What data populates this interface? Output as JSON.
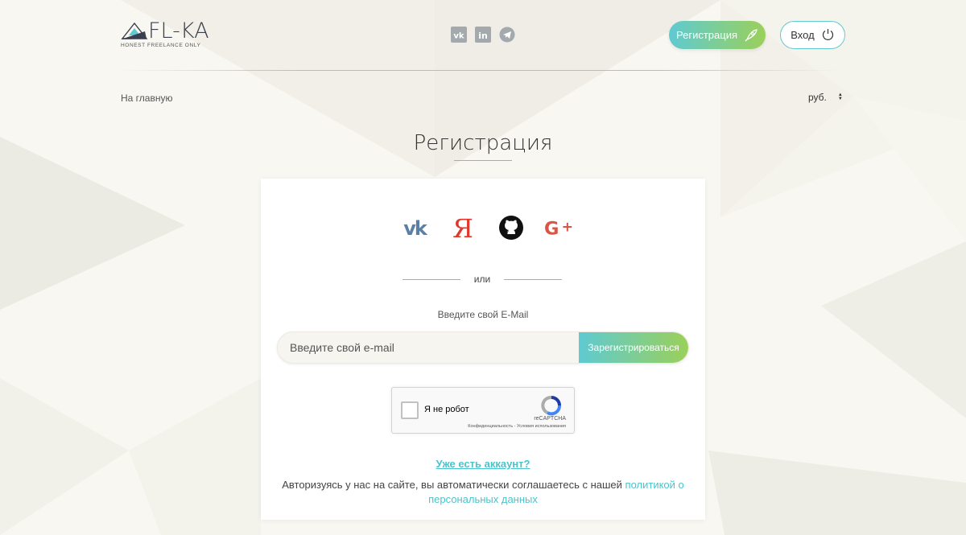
{
  "header": {
    "logo_name": "FL-KA",
    "logo_tagline": "HONEST FREELANCE ONLY",
    "social_icons": [
      "vk-icon",
      "linkedin-icon",
      "telegram-icon"
    ],
    "register_label": "Регистрация",
    "login_label": "Вход"
  },
  "nav": {
    "home_label": "На главную",
    "currency": "руб."
  },
  "main": {
    "title": "Регистрация",
    "social_auth": [
      "vk-icon",
      "yandex-icon",
      "github-icon",
      "google-plus-icon"
    ],
    "or_label": "или",
    "email_label": "Введите свой E-Mail",
    "email_placeholder": "Введите свой e-mail",
    "submit_label": "Зарегистрироваться",
    "captcha": {
      "label": "Я не робот",
      "brand": "reCAPTCHA",
      "terms": "Конфиденциальность - Условия использования"
    },
    "already_label": "Уже есть аккаунт?",
    "agree_text": "Авторизуясь у нас на сайте, вы автоматически соглашаетесь с нашей ",
    "agree_link": "политикой о персональных данных"
  },
  "colors": {
    "accent_teal": "#5fcad1",
    "accent_green": "#9bd05a",
    "link": "#4bc3cc",
    "background": "#f6f5ef"
  }
}
